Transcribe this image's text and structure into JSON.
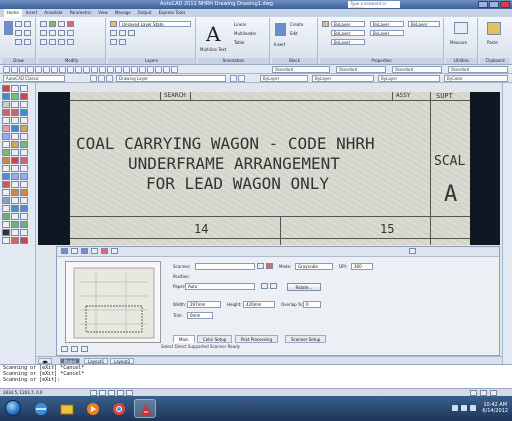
{
  "window": {
    "title": "AutoCAD 2011  NHRH Drawing  Drawing1.dwg",
    "search_placeholder": "Type a keyword or phrase"
  },
  "ribbon_tabs": [
    "Home",
    "Insert",
    "Annotate",
    "Parametric",
    "View",
    "Manage",
    "Output",
    "Express Tools"
  ],
  "ribbon": {
    "panels": [
      "Draw",
      "Modify",
      "Layers",
      "Annotation",
      "Block",
      "Properties",
      "Utilities",
      "Clipboard"
    ],
    "layer_combo": "Unsaved Layer State",
    "text_label": "Multiline Text",
    "linear_label": "Linear",
    "multileader_label": "Multileader",
    "table_label": "Table",
    "insert_label": "Insert",
    "create_label": "Create",
    "edit_label": "Edit",
    "bylayer": "ByLayer",
    "measure_label": "Measure",
    "paste_label": "Paste"
  },
  "toolbars": {
    "text_style": "Standard",
    "dim_style": "Standard",
    "table_style": "Standard",
    "mleader_style": "Standard",
    "layer_state": "Drawing Layer",
    "color": "ByLayer",
    "linetype": "ByLayer",
    "lineweight": "ByLayer",
    "plot_style": "ByColor",
    "workspace": "AutoCAD Classic"
  },
  "drawing": {
    "header_left": "SEARCH",
    "header_right": "ASSY",
    "header_far": "SUPT",
    "line1": "COAL CARRYING WAGON - CODE NHRH",
    "line2": "UNDERFRAME ARRANGEMENT",
    "line3": "FOR LEAD WAGON ONLY",
    "sheet_left": "14",
    "sheet_right": "15",
    "scale_label": "SCAL",
    "size_label": "A"
  },
  "dialog": {
    "scanner_label": "Scanner:",
    "scanner_value": "",
    "position_label": "Position:",
    "paper_label": "Paper:",
    "paper_value": "Auto",
    "mode_label": "Mode:",
    "mode_value": "Grayscale",
    "dpi_label": "DPI:",
    "dpi_value": "300",
    "rotate_button": "Rotate...",
    "width_label": "Width:",
    "width_value": "297mm",
    "height_label": "Height:",
    "height_value": "420mm",
    "overlap_label": "Overlap %:",
    "overlap_value": "0",
    "trim_label": "Trim:",
    "trim_value": "0mm",
    "tabs": [
      "Main",
      "Color Setup",
      "Post Processing",
      "Scanner Setup"
    ],
    "status": "Select Direct Supported Scanner Ready"
  },
  "layout_tabs": [
    "Model",
    "Layout1",
    "Layout2"
  ],
  "command_history": [
    "Scanning or [eXit] *Cancel*",
    "Scanning or [eXit] *Cancel*",
    "Scanning or [eXit]:"
  ],
  "status": {
    "coords": "2834.5, 1203.7, 0.0"
  },
  "colors": {
    "accent": "#3d5f98",
    "drawing_bg": "#0f1722",
    "taskbar": "#1d3557"
  },
  "taskbar": {
    "time": "10:42 AM",
    "date": "6/14/2012",
    "apps": [
      "ie-icon",
      "folder-icon",
      "media-player-icon",
      "chrome-icon",
      "autocad-icon"
    ]
  }
}
